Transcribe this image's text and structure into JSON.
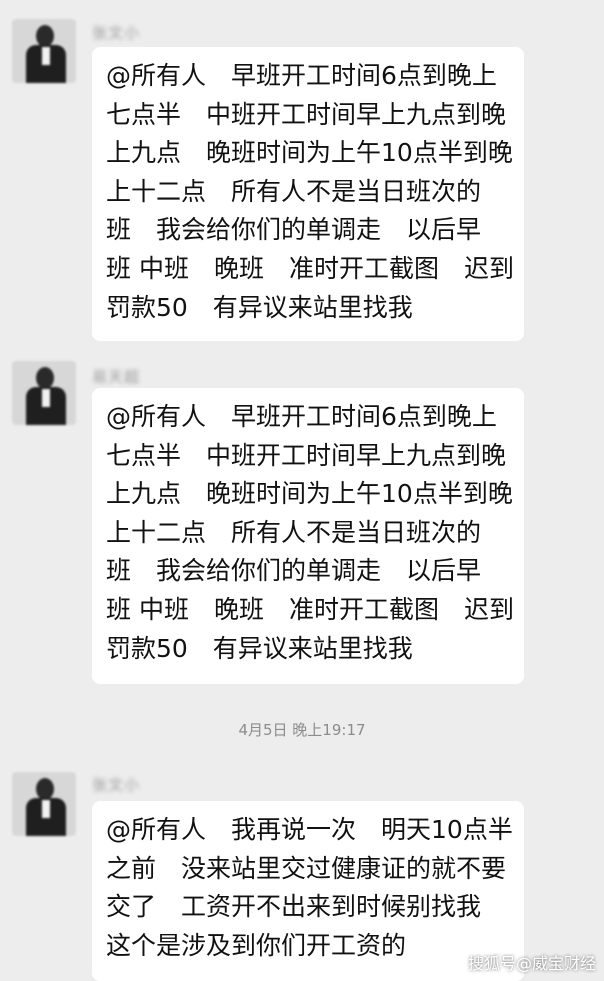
{
  "messages": [
    {
      "sender": "张文小",
      "lines": [
        "@所有人　早班开工时间6点到晚上",
        "七点半　中班开工时间早上九点到晚",
        "上九点　晚班时间为上午10点半到晚",
        "上十二点　所有人不是当日班次的",
        "班　我会给你们的单调走　以后早",
        "班 中班　晚班　准时开工截图　迟到",
        "罚款50　有异议来站里找我"
      ]
    },
    {
      "sender": "易天超",
      "lines": [
        "@所有人　早班开工时间6点到晚上",
        "七点半　中班开工时间早上九点到晚",
        "上九点　晚班时间为上午10点半到晚",
        "上十二点　所有人不是当日班次的",
        "班　我会给你们的单调走　以后早",
        "班 中班　晚班　准时开工截图　迟到",
        "罚款50　有异议来站里找我"
      ]
    },
    {
      "sender": "张文小",
      "lines": [
        "@所有人　我再说一次　明天10点半",
        "之前　没来站里交过健康证的就不要",
        "交了　工资开不出来到时候别找我",
        "这个是涉及到你们开工资的"
      ]
    }
  ],
  "timestamp": "4月5日 晚上19:17",
  "watermark": "搜狐号@威宝财经"
}
